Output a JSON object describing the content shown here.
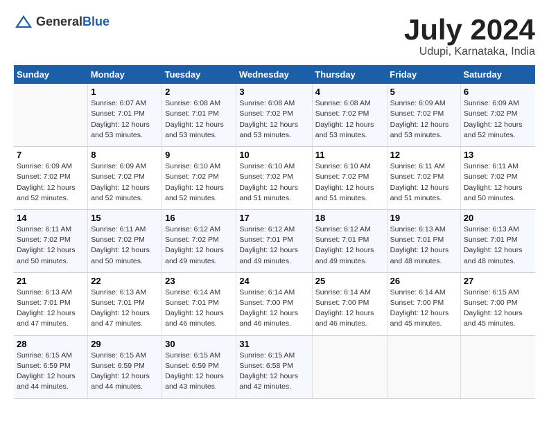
{
  "header": {
    "logo_general": "General",
    "logo_blue": "Blue",
    "month": "July 2024",
    "location": "Udupi, Karnataka, India"
  },
  "weekdays": [
    "Sunday",
    "Monday",
    "Tuesday",
    "Wednesday",
    "Thursday",
    "Friday",
    "Saturday"
  ],
  "weeks": [
    [
      {
        "num": "",
        "info": ""
      },
      {
        "num": "1",
        "info": "Sunrise: 6:07 AM\nSunset: 7:01 PM\nDaylight: 12 hours\nand 53 minutes."
      },
      {
        "num": "2",
        "info": "Sunrise: 6:08 AM\nSunset: 7:01 PM\nDaylight: 12 hours\nand 53 minutes."
      },
      {
        "num": "3",
        "info": "Sunrise: 6:08 AM\nSunset: 7:02 PM\nDaylight: 12 hours\nand 53 minutes."
      },
      {
        "num": "4",
        "info": "Sunrise: 6:08 AM\nSunset: 7:02 PM\nDaylight: 12 hours\nand 53 minutes."
      },
      {
        "num": "5",
        "info": "Sunrise: 6:09 AM\nSunset: 7:02 PM\nDaylight: 12 hours\nand 53 minutes."
      },
      {
        "num": "6",
        "info": "Sunrise: 6:09 AM\nSunset: 7:02 PM\nDaylight: 12 hours\nand 52 minutes."
      }
    ],
    [
      {
        "num": "7",
        "info": "Sunrise: 6:09 AM\nSunset: 7:02 PM\nDaylight: 12 hours\nand 52 minutes."
      },
      {
        "num": "8",
        "info": "Sunrise: 6:09 AM\nSunset: 7:02 PM\nDaylight: 12 hours\nand 52 minutes."
      },
      {
        "num": "9",
        "info": "Sunrise: 6:10 AM\nSunset: 7:02 PM\nDaylight: 12 hours\nand 52 minutes."
      },
      {
        "num": "10",
        "info": "Sunrise: 6:10 AM\nSunset: 7:02 PM\nDaylight: 12 hours\nand 51 minutes."
      },
      {
        "num": "11",
        "info": "Sunrise: 6:10 AM\nSunset: 7:02 PM\nDaylight: 12 hours\nand 51 minutes."
      },
      {
        "num": "12",
        "info": "Sunrise: 6:11 AM\nSunset: 7:02 PM\nDaylight: 12 hours\nand 51 minutes."
      },
      {
        "num": "13",
        "info": "Sunrise: 6:11 AM\nSunset: 7:02 PM\nDaylight: 12 hours\nand 50 minutes."
      }
    ],
    [
      {
        "num": "14",
        "info": "Sunrise: 6:11 AM\nSunset: 7:02 PM\nDaylight: 12 hours\nand 50 minutes."
      },
      {
        "num": "15",
        "info": "Sunrise: 6:11 AM\nSunset: 7:02 PM\nDaylight: 12 hours\nand 50 minutes."
      },
      {
        "num": "16",
        "info": "Sunrise: 6:12 AM\nSunset: 7:02 PM\nDaylight: 12 hours\nand 49 minutes."
      },
      {
        "num": "17",
        "info": "Sunrise: 6:12 AM\nSunset: 7:01 PM\nDaylight: 12 hours\nand 49 minutes."
      },
      {
        "num": "18",
        "info": "Sunrise: 6:12 AM\nSunset: 7:01 PM\nDaylight: 12 hours\nand 49 minutes."
      },
      {
        "num": "19",
        "info": "Sunrise: 6:13 AM\nSunset: 7:01 PM\nDaylight: 12 hours\nand 48 minutes."
      },
      {
        "num": "20",
        "info": "Sunrise: 6:13 AM\nSunset: 7:01 PM\nDaylight: 12 hours\nand 48 minutes."
      }
    ],
    [
      {
        "num": "21",
        "info": "Sunrise: 6:13 AM\nSunset: 7:01 PM\nDaylight: 12 hours\nand 47 minutes."
      },
      {
        "num": "22",
        "info": "Sunrise: 6:13 AM\nSunset: 7:01 PM\nDaylight: 12 hours\nand 47 minutes."
      },
      {
        "num": "23",
        "info": "Sunrise: 6:14 AM\nSunset: 7:01 PM\nDaylight: 12 hours\nand 46 minutes."
      },
      {
        "num": "24",
        "info": "Sunrise: 6:14 AM\nSunset: 7:00 PM\nDaylight: 12 hours\nand 46 minutes."
      },
      {
        "num": "25",
        "info": "Sunrise: 6:14 AM\nSunset: 7:00 PM\nDaylight: 12 hours\nand 46 minutes."
      },
      {
        "num": "26",
        "info": "Sunrise: 6:14 AM\nSunset: 7:00 PM\nDaylight: 12 hours\nand 45 minutes."
      },
      {
        "num": "27",
        "info": "Sunrise: 6:15 AM\nSunset: 7:00 PM\nDaylight: 12 hours\nand 45 minutes."
      }
    ],
    [
      {
        "num": "28",
        "info": "Sunrise: 6:15 AM\nSunset: 6:59 PM\nDaylight: 12 hours\nand 44 minutes."
      },
      {
        "num": "29",
        "info": "Sunrise: 6:15 AM\nSunset: 6:59 PM\nDaylight: 12 hours\nand 44 minutes."
      },
      {
        "num": "30",
        "info": "Sunrise: 6:15 AM\nSunset: 6:59 PM\nDaylight: 12 hours\nand 43 minutes."
      },
      {
        "num": "31",
        "info": "Sunrise: 6:15 AM\nSunset: 6:58 PM\nDaylight: 12 hours\nand 42 minutes."
      },
      {
        "num": "",
        "info": ""
      },
      {
        "num": "",
        "info": ""
      },
      {
        "num": "",
        "info": ""
      }
    ]
  ]
}
